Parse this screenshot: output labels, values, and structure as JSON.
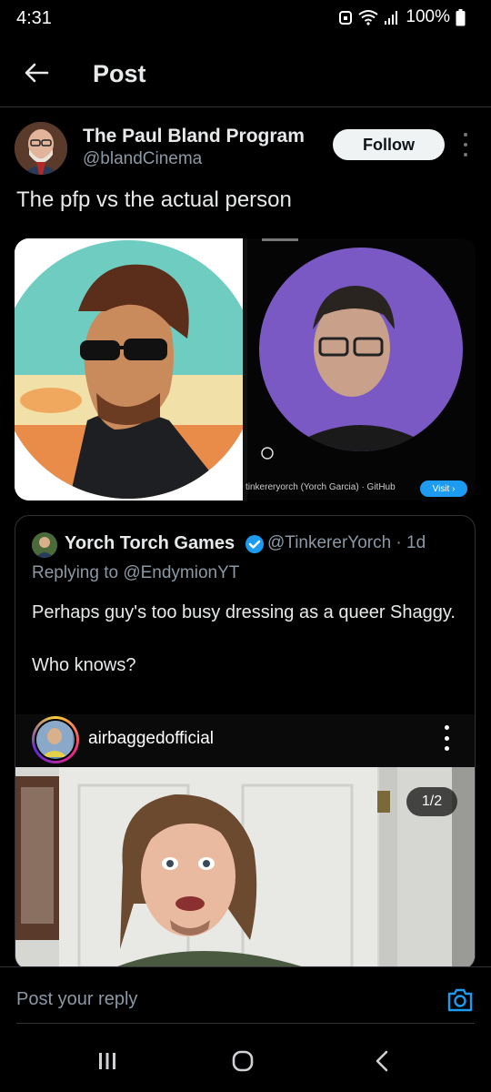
{
  "status_bar": {
    "time": "4:31",
    "battery": "100%"
  },
  "app_bar": {
    "title": "Post"
  },
  "post": {
    "author_name": "The Paul Bland Program",
    "author_handle": "@blandCinema",
    "follow_label": "Follow",
    "text": "The pfp vs the actual person",
    "media_caption": "tinkereryorch (Yorch Garcia) · GitHub",
    "visit_label": "Visit ›"
  },
  "quote": {
    "name": "Yorch Torch Games",
    "handle": "@TinkererYorch · 1d",
    "replying_to": "Replying to @EndymionYT",
    "body_lines": [
      "Perhaps guy's too busy dressing as a queer Shaggy.",
      "",
      "Who knows?"
    ],
    "embed_account": "airbaggedofficial",
    "page_indicator": "1/2"
  },
  "reply_bar": {
    "placeholder": "Post your reply"
  },
  "colors": {
    "accent": "#1d9bf0",
    "background": "#000000",
    "secondary_text": "#8b98a5"
  },
  "icons": [
    "back-arrow-icon",
    "more-vertical-icon",
    "verified-badge-icon",
    "camera-icon",
    "recents-icon",
    "home-icon",
    "back-nav-icon",
    "wifi-icon",
    "signal-icon",
    "battery-icon",
    "alarm-icon"
  ]
}
